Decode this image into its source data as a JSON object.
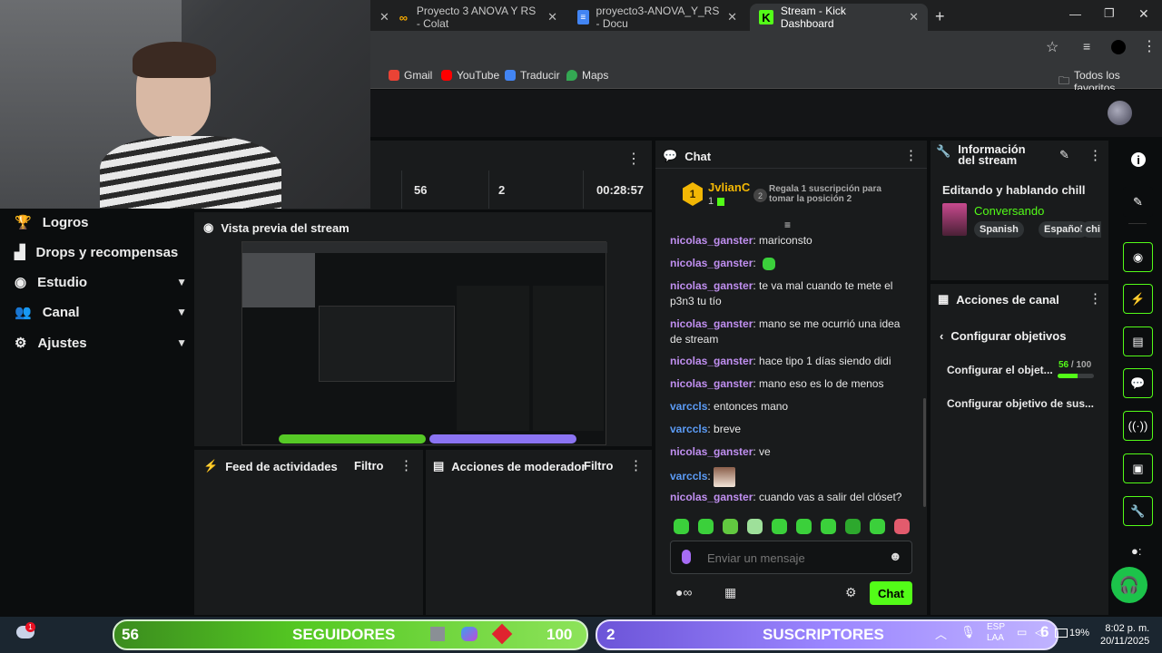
{
  "browser": {
    "tabs": [
      {
        "title": "Proyecto 3 ANOVA Y RS - Colat",
        "icon_color": "#f9ab00"
      },
      {
        "title": "proyecto3-ANOVA_Y_RS - Docu",
        "icon_color": "#4285f4"
      },
      {
        "title": "Stream - Kick Dashboard",
        "icon_color": "#53fc18"
      }
    ],
    "bookmarks": [
      "Gmail",
      "YouTube",
      "Traducir",
      "Maps"
    ],
    "all_bookmarks": "Todos los favoritos"
  },
  "nav": {
    "items": [
      "Logros",
      "Drops y recompensas",
      "Estudio",
      "Canal",
      "Ajustes"
    ]
  },
  "stats": {
    "a": "56",
    "b": "2",
    "uptime": "00:28:57"
  },
  "preview": {
    "title": "Vista previa del stream"
  },
  "feed": {
    "title": "Feed de actividades",
    "filter": "Filtro"
  },
  "mod": {
    "title": "Acciones de moderador",
    "filter": "Filtro"
  },
  "chat": {
    "title": "Chat",
    "top_user": "JvlianC",
    "top_rank": "1",
    "top_badge": "1",
    "gift_count": "2",
    "gift_text": "Regala 1 suscripción para tomar la posición 2",
    "messages": [
      {
        "user": "nicolas_ganster",
        "text": "mariconsto",
        "color": "u1"
      },
      {
        "user": "nicolas_ganster",
        "text": "",
        "color": "u1",
        "emote": true
      },
      {
        "user": "nicolas_ganster",
        "text": "te va mal cuando te mete el p3n3 tu tío",
        "color": "u1"
      },
      {
        "user": "nicolas_ganster",
        "text": "mano se me ocurrió una idea de stream",
        "color": "u1"
      },
      {
        "user": "nicolas_ganster",
        "text": "hace tipo 1 días siendo didi",
        "color": "u1"
      },
      {
        "user": "nicolas_ganster",
        "text": "mano eso es lo de menos",
        "color": "u1"
      },
      {
        "user": "varccls",
        "text": "entonces mano",
        "color": "u2"
      },
      {
        "user": "varccls",
        "text": "breve",
        "color": "u2"
      },
      {
        "user": "nicolas_ganster",
        "text": "ve",
        "color": "u1"
      },
      {
        "user": "varccls",
        "text": "",
        "color": "u2",
        "image": true
      },
      {
        "user": "nicolas_ganster",
        "text": "cuando vas a salir del clóset?",
        "color": "u1"
      }
    ],
    "input_placeholder": "Enviar un mensaje",
    "send_label": "Chat"
  },
  "info": {
    "title": "Información del stream",
    "stream_title": "Editando y hablando chill",
    "category": "Conversando",
    "tags": [
      "Spanish",
      "Español",
      "chi"
    ]
  },
  "channel_actions": {
    "title": "Acciones de canal",
    "back_label": "Configurar objetivos",
    "goal1_label": "Configurar el objet...",
    "goal1_value": "56",
    "goal1_total": "/ 100",
    "goal1_progress": 0.56,
    "goal2_label": "Configurar objetivo de sus..."
  },
  "taskbar": {
    "followers_count": "56",
    "followers_label": "SEGUIDORES",
    "followers_goal": "100",
    "subs_count": "2",
    "subs_label": "SUSCRIPTORES",
    "lang1": "ESP",
    "lang2": "LAA",
    "battery_num": "6",
    "battery": "19%",
    "time": "8:02 p. m.",
    "date": "20/11/2025",
    "notif": "1"
  },
  "colors": {
    "kick_green": "#53fc18",
    "panel": "#191b1c"
  }
}
